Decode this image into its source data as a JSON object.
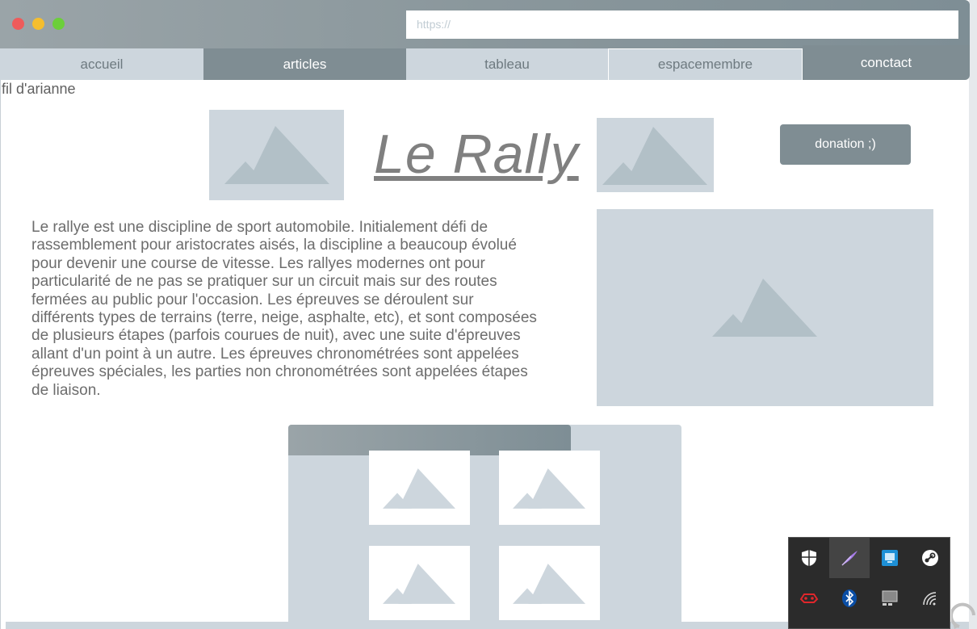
{
  "browser": {
    "url_placeholder": "https://"
  },
  "nav": {
    "tabs": [
      {
        "label": "accueil"
      },
      {
        "label": "articles"
      },
      {
        "label": "tableau"
      },
      {
        "label": "espacemembre"
      },
      {
        "label": "conctact"
      }
    ]
  },
  "breadcrumb": "fil d'arianne",
  "header": {
    "title": "Le Rally",
    "donate_label": "donation ;)"
  },
  "article": {
    "body": "Le rallye est une discipline de sport automobile. Initialement défi de rassemblement pour aristocrates aisés, la discipline a beaucoup évolué pour devenir une course de vitesse. Les rallyes modernes ont pour particularité de ne pas se pratiquer sur un circuit mais sur des routes fermées au public pour l'occasion. Les épreuves se déroulent sur différents types de terrains (terre, neige, asphalte, etc), et sont composées de plusieurs étapes (parfois courues de nuit), avec une suite d'épreuves allant d'un point à un autre. Les épreuves chronométrées sont appelées épreuves spéciales, les parties non chronométrées sont appelées étapes de liaison."
  },
  "system_tray": {
    "icons": [
      "shield-icon",
      "feather-icon",
      "monitor-icon",
      "steam-icon",
      "game-controller-icon",
      "bluetooth-icon",
      "display-icon",
      "wifi-icon"
    ]
  },
  "colors": {
    "accent": "#7f8d93",
    "placeholder": "#cdd6dd",
    "mountain": "#b2c0c7"
  }
}
